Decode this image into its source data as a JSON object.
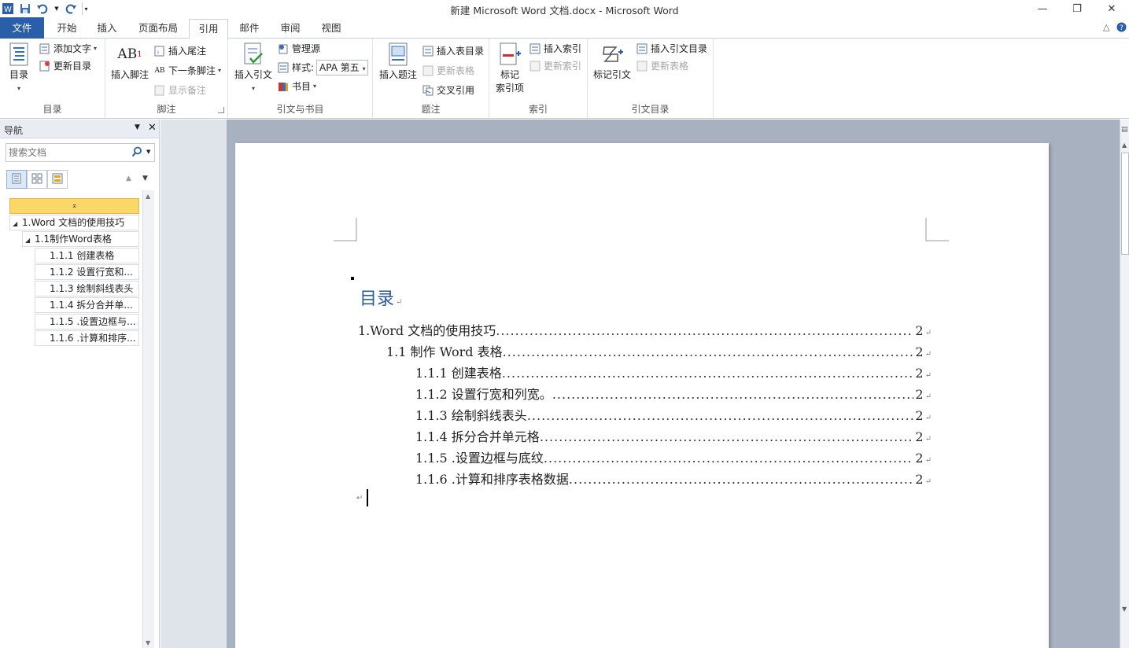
{
  "window": {
    "title": "新建 Microsoft Word 文档.docx - Microsoft Word",
    "controls": {
      "minimize": "—",
      "restore": "❐",
      "close": "✕"
    }
  },
  "tabs": [
    {
      "label": "文件",
      "kind": "file"
    },
    {
      "label": "开始"
    },
    {
      "label": "插入"
    },
    {
      "label": "页面布局"
    },
    {
      "label": "引用",
      "active": true
    },
    {
      "label": "邮件"
    },
    {
      "label": "审阅"
    },
    {
      "label": "视图"
    }
  ],
  "ribbon": {
    "toc_group": {
      "label": "目录",
      "toc_button": "目录",
      "add_text": "添加文字",
      "update_toc": "更新目录"
    },
    "footnote_group": {
      "label": "脚注",
      "insert_footnote": "插入脚注",
      "insert_endnote": "插入尾注",
      "next_footnote": "下一条脚注",
      "show_notes": "显示备注"
    },
    "citation_group": {
      "label": "引文与书目",
      "insert_citation": "插入引文",
      "manage_sources": "管理源",
      "style_label": "样式:",
      "style_value": "APA 第五",
      "bibliography": "书目"
    },
    "caption_group": {
      "label": "题注",
      "insert_caption": "插入题注",
      "insert_table_of_figures": "插入表目录",
      "update_table": "更新表格",
      "cross_reference": "交叉引用"
    },
    "index_group": {
      "label": "索引",
      "mark_entry_line1": "标记",
      "mark_entry_line2": "索引项",
      "insert_index": "插入索引",
      "update_index": "更新索引"
    },
    "toa_group": {
      "label": "引文目录",
      "mark_citation": "标记引文",
      "insert_toa": "插入引文目录",
      "update_table": "更新表格"
    }
  },
  "nav": {
    "title": "导航",
    "search_placeholder": "搜索文档",
    "tree": [
      {
        "label": "1.Word 文档的使用技巧",
        "level": 1
      },
      {
        "label": "1.1制作Word表格",
        "level": 2
      },
      {
        "label": "1.1.1 创建表格",
        "level": 3
      },
      {
        "label": "1.1.2 设置行宽和...",
        "level": 3
      },
      {
        "label": "1.1.3 绘制斜线表头",
        "level": 3
      },
      {
        "label": "1.1.4 拆分合并单...",
        "level": 3
      },
      {
        "label": "1.1.5 .设置边框与...",
        "level": 3
      },
      {
        "label": "1.1.6 .计算和排序...",
        "level": 3
      }
    ]
  },
  "document": {
    "toc_heading": "目录",
    "toc_entries": [
      {
        "text": "1.Word  文档的使用技巧",
        "page": "2",
        "level": 1
      },
      {
        "text": "1.1 制作 Word 表格",
        "page": "2",
        "level": 2
      },
      {
        "text": "1.1.1  创建表格",
        "page": "2",
        "level": 3
      },
      {
        "text": "1.1.2  设置行宽和列宽。",
        "page": "2",
        "level": 3
      },
      {
        "text": "1.1.3  绘制斜线表头",
        "page": "2",
        "level": 3
      },
      {
        "text": "1.1.4  拆分合并单元格",
        "page": "2",
        "level": 3
      },
      {
        "text": "1.1.5 .设置边框与底纹",
        "page": "2",
        "level": 3
      },
      {
        "text": "1.1.6 .计算和排序表格数据",
        "page": "2",
        "level": 3
      }
    ]
  },
  "colors": {
    "file_tab": "#2b5ea9",
    "heading": "#2e5b96",
    "nav_selected": "#fbd767"
  }
}
